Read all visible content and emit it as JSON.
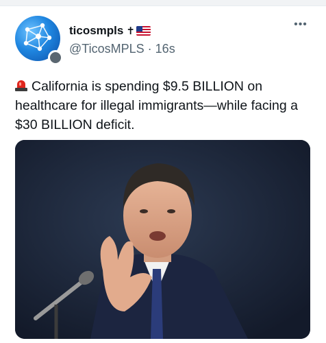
{
  "user": {
    "display_name": "ticosmpls",
    "name_emoji": "✝",
    "handle": "@TicosMPLS",
    "separator": "·",
    "time": "16s"
  },
  "tweet": {
    "text": "California is spending $9.5 BILLION on healthcare for illegal immigrants—while facing a $30 BILLION deficit."
  },
  "icons": {
    "more": "more-options-icon",
    "siren": "police-light-icon",
    "flag": "us-flag-icon"
  },
  "colors": {
    "text": "#0f1419",
    "secondary": "#536471",
    "avatar_blue": "#1f86e0"
  }
}
